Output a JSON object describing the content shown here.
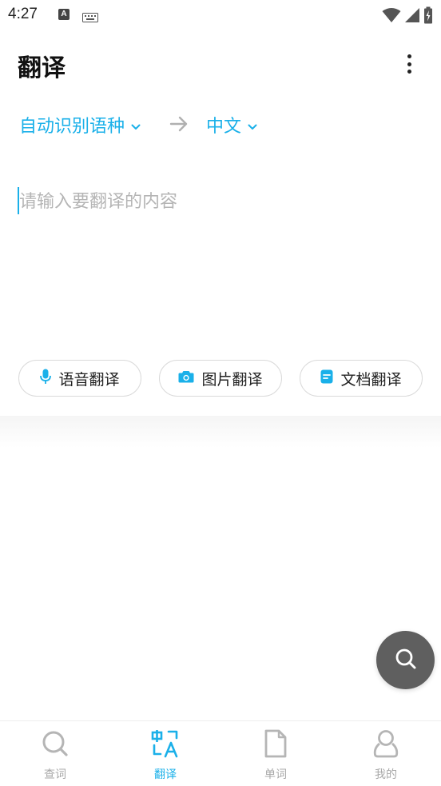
{
  "status_bar": {
    "time": "4:27",
    "icons": [
      "a-notification-icon",
      "keyboard-icon",
      "wifi-icon",
      "signal-icon",
      "battery-charging-icon"
    ]
  },
  "header": {
    "title": "翻译",
    "more_icon": "more-vertical-icon"
  },
  "language": {
    "source": "自动识别语种",
    "target": "中文",
    "arrow_icon": "arrow-right-icon",
    "dropdown_icon": "chevron-down-icon"
  },
  "input": {
    "placeholder": "请输入要翻译的内容",
    "value": ""
  },
  "actions": [
    {
      "label": "语音翻译",
      "icon": "microphone-icon"
    },
    {
      "label": "图片翻译",
      "icon": "camera-icon"
    },
    {
      "label": "文档翻译",
      "icon": "document-icon"
    }
  ],
  "fab": {
    "icon": "search-icon"
  },
  "bottom_nav": [
    {
      "label": "查词",
      "icon": "search-icon",
      "active": false
    },
    {
      "label": "翻译",
      "icon": "translate-icon",
      "active": true
    },
    {
      "label": "单词",
      "icon": "file-icon",
      "active": false
    },
    {
      "label": "我的",
      "icon": "user-icon",
      "active": false
    }
  ],
  "colors": {
    "accent": "#1ab0e9",
    "inactive": "#a8a8a8",
    "fab": "#5f5f5f"
  }
}
